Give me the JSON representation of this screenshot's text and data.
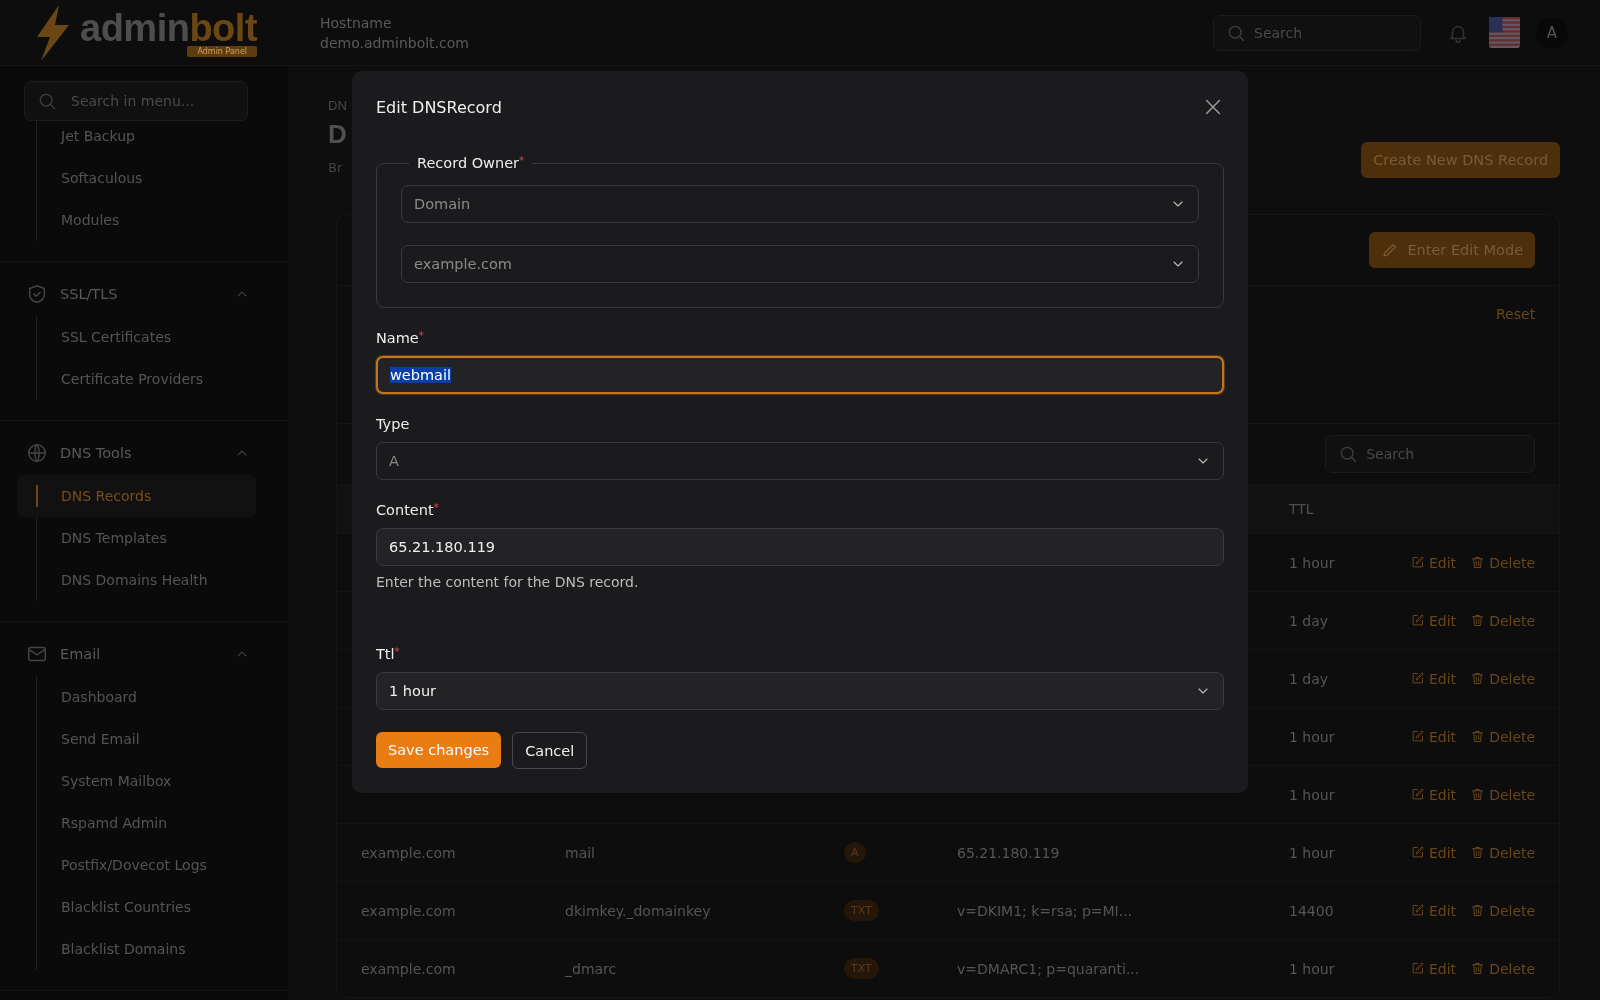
{
  "header": {
    "logo": {
      "primary": "admin",
      "accent": "bolt",
      "badge": "Admin Panel"
    },
    "hostname_label": "Hostname",
    "hostname": "demo.adminbolt.com",
    "search": {
      "placeholder": "Search"
    },
    "avatar": "A"
  },
  "sidebar": {
    "search": {
      "placeholder": "Search in menu..."
    },
    "groups": [
      {
        "items": [
          {
            "label": "Jet Backup",
            "selected": false
          },
          {
            "label": "Softaculous",
            "selected": false
          },
          {
            "label": "Modules",
            "selected": false
          }
        ]
      },
      {
        "title": "SSL/TLS",
        "expanded": true,
        "items": [
          {
            "label": "SSL Certificates",
            "selected": false
          },
          {
            "label": "Certificate Providers",
            "selected": false
          }
        ]
      },
      {
        "title": "DNS Tools",
        "expanded": true,
        "items": [
          {
            "label": "DNS Records",
            "selected": true
          },
          {
            "label": "DNS Templates",
            "selected": false
          },
          {
            "label": "DNS Domains Health",
            "selected": false
          }
        ]
      },
      {
        "title": "Email",
        "expanded": true,
        "items": [
          {
            "label": "Dashboard",
            "selected": false
          },
          {
            "label": "Send Email",
            "selected": false
          },
          {
            "label": "System Mailbox",
            "selected": false
          },
          {
            "label": "Rspamd Admin",
            "selected": false
          },
          {
            "label": "Postfix/Dovecot Logs",
            "selected": false
          },
          {
            "label": "Blacklist Countries",
            "selected": false
          },
          {
            "label": "Blacklist Domains",
            "selected": false
          }
        ]
      }
    ]
  },
  "page": {
    "breadcrumb": "DN",
    "title": "D",
    "description": "Br",
    "create_button": "Create New DNS Record",
    "edit_mode_button": "Enter Edit Mode",
    "reset": "Reset",
    "table_search": {
      "placeholder": "Search"
    },
    "table": {
      "ttl_column": "TTL",
      "rows": [
        {
          "ttl": "1 hour",
          "edit": "Edit",
          "delete": "Delete"
        },
        {
          "ttl": "1 day",
          "edit": "Edit",
          "delete": "Delete"
        },
        {
          "ttl": "1 day",
          "edit": "Edit",
          "delete": "Delete"
        },
        {
          "ttl": "1 hour",
          "edit": "Edit",
          "delete": "Delete"
        },
        {
          "ttl": "1 hour",
          "edit": "Edit",
          "delete": "Delete"
        },
        {
          "domain": "example.com",
          "name": "mail",
          "type": "A",
          "content": "65.21.180.119",
          "ttl": "1 hour",
          "edit": "Edit",
          "delete": "Delete"
        },
        {
          "domain": "example.com",
          "name": "dkimkey._domainkey",
          "type": "TXT",
          "content": "v=DKIM1; k=rsa; p=MI...",
          "ttl": "14400",
          "edit": "Edit",
          "delete": "Delete"
        },
        {
          "domain": "example.com",
          "name": "_dmarc",
          "type": "TXT",
          "content": "v=DMARC1; p=quaranti...",
          "ttl": "1 hour",
          "edit": "Edit",
          "delete": "Delete"
        }
      ]
    }
  },
  "modal": {
    "title": "Edit DNSRecord",
    "record_owner": {
      "legend": "Record Owner$^{*}$",
      "selects": [
        {
          "value": "Domain",
          "disabled": true
        },
        {
          "value": "example.com",
          "disabled": true
        }
      ]
    },
    "fields": [
      {
        "kind": "input",
        "label": "Name$^{*}$",
        "value": "webmail",
        "focused": true,
        "disabled": false
      },
      {
        "kind": "select",
        "label": "Type",
        "value": "A",
        "focused": false,
        "disabled": true
      },
      {
        "kind": "input",
        "label": "Content$^{*}$",
        "value": "65.21.180.119",
        "help": "Enter the content for the DNS record.",
        "focused": false,
        "disabled": false
      },
      {
        "kind": "select",
        "label": "Ttl$^{*}$",
        "value": "1 hour",
        "focused": false,
        "disabled": false
      }
    ],
    "save_button": "Save changes",
    "cancel_button": "Cancel"
  }
}
